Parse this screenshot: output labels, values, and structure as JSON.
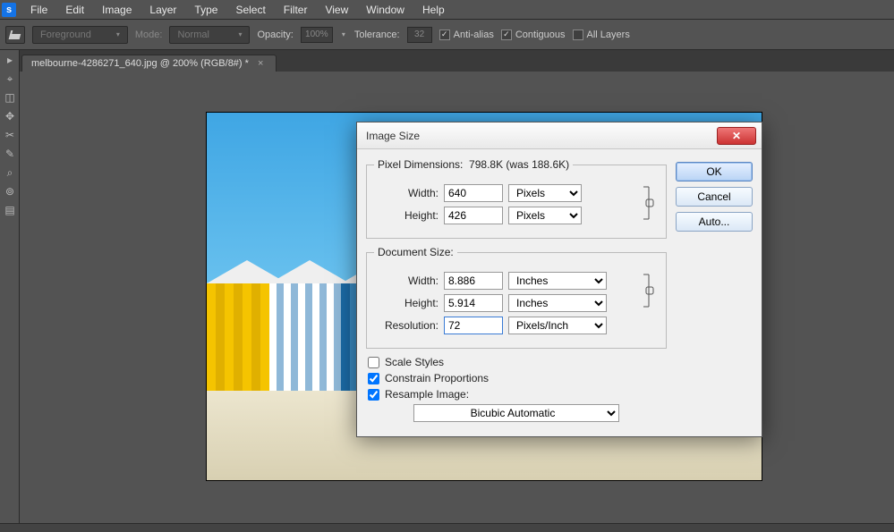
{
  "menubar": {
    "items": [
      "File",
      "Edit",
      "Image",
      "Layer",
      "Type",
      "Select",
      "Filter",
      "View",
      "Window",
      "Help"
    ]
  },
  "optionsbar": {
    "foreground_label": "Foreground",
    "mode_label": "Mode:",
    "mode_value": "Normal",
    "opacity_label": "Opacity:",
    "opacity_value": "100%",
    "tolerance_label": "Tolerance:",
    "tolerance_value": "32",
    "anti_alias": "Anti-alias",
    "contiguous": "Contiguous",
    "all_layers": "All Layers"
  },
  "doctab": {
    "title": "melbourne-4286271_640.jpg @ 200% (RGB/8#) *",
    "close": "×"
  },
  "dialog": {
    "title": "Image Size",
    "pixel_legend_prefix": "Pixel Dimensions:",
    "pixel_legend_value": "798.8K (was 188.6K)",
    "width_label": "Width:",
    "height_label": "Height:",
    "resolution_label": "Resolution:",
    "pixel_width": "640",
    "pixel_height": "426",
    "pixel_unit": "Pixels",
    "doc_legend": "Document Size:",
    "doc_width": "8.886",
    "doc_height": "5.914",
    "doc_unit": "Inches",
    "resolution": "72",
    "resolution_unit": "Pixels/Inch",
    "scale_styles": "Scale Styles",
    "constrain": "Constrain Proportions",
    "resample": "Resample Image:",
    "resample_method": "Bicubic Automatic",
    "ok": "OK",
    "cancel": "Cancel",
    "auto": "Auto..."
  }
}
